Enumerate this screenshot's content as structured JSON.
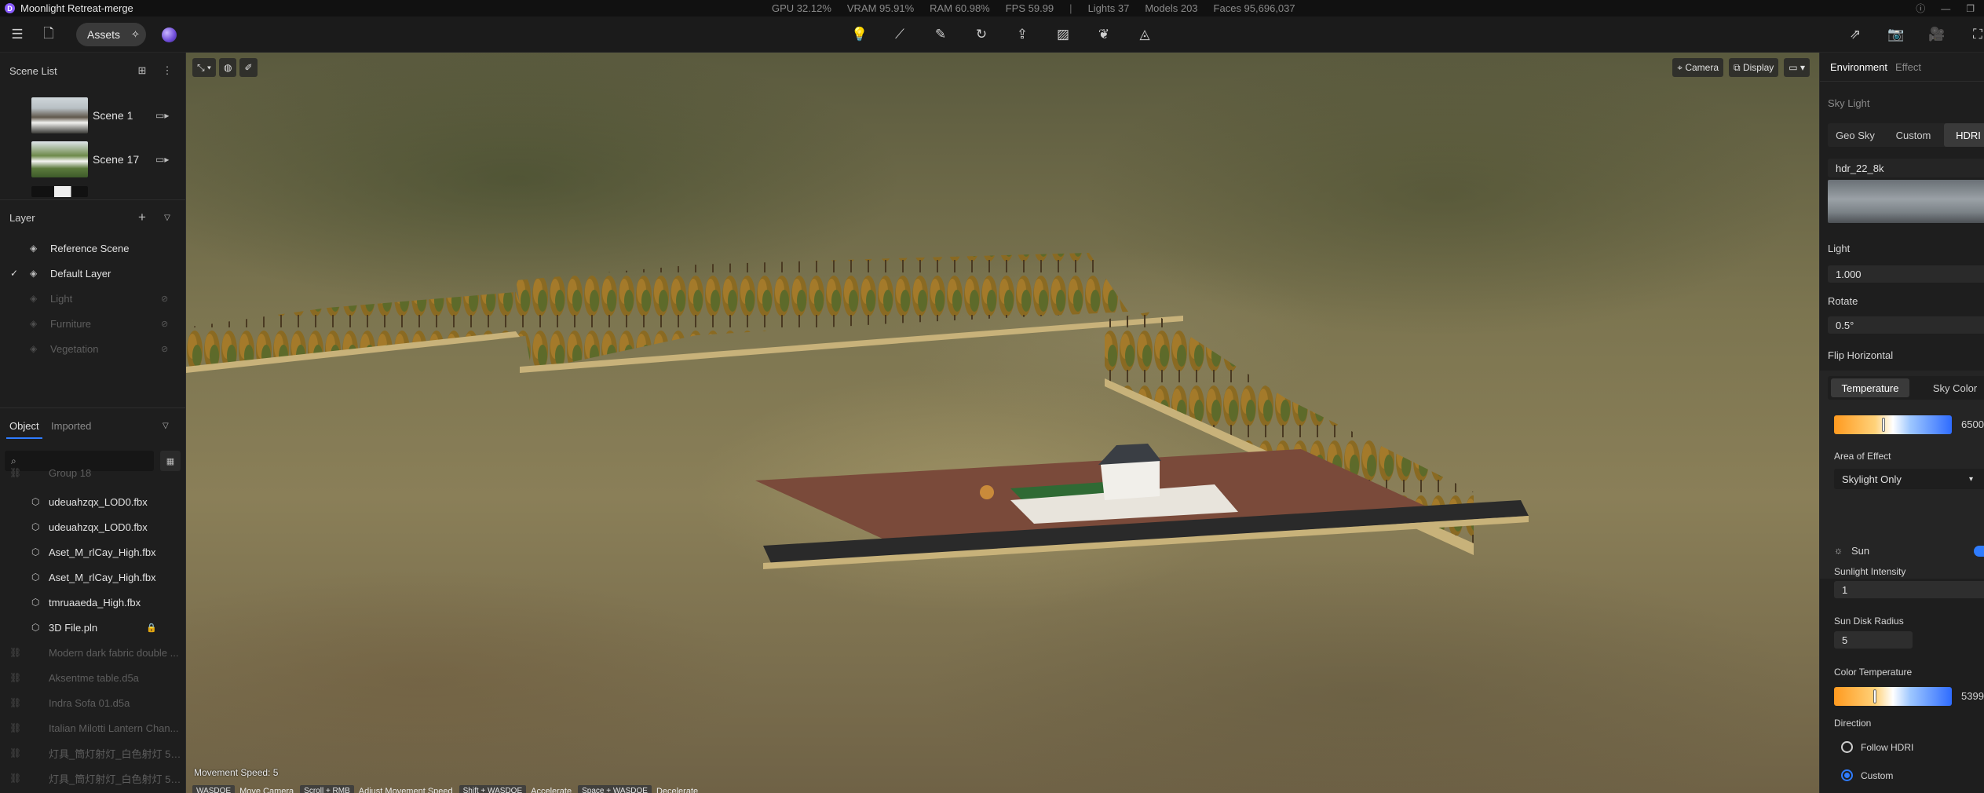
{
  "titlebar": {
    "app_icon": "D",
    "title": "Moonlight Retreat-merge",
    "stats": [
      "GPU 32.12%",
      "VRAM 95.91%",
      "RAM 60.98%",
      "FPS 59.99",
      "|",
      "Lights 37",
      "Models 203",
      "Faces 95,696,037"
    ],
    "window_controls": [
      "help-icon",
      "minimize-icon",
      "maximize-icon"
    ]
  },
  "toolbar": {
    "assets_label": "Assets",
    "center_tools": [
      "light-icon",
      "path-icon",
      "feather-icon",
      "rotate-icon",
      "import-icon",
      "material-icon",
      "plant-icon",
      "terrain-icon"
    ],
    "right_tools": [
      "export-icon",
      "camera-icon",
      "video-icon",
      "render-icon"
    ]
  },
  "scene_list": {
    "title": "Scene List",
    "scenes": [
      {
        "label": "Scene 1"
      },
      {
        "label": "Scene 17"
      }
    ]
  },
  "layers": {
    "title": "Layer",
    "items": [
      {
        "label": "Reference Scene",
        "checked": false,
        "visible": true
      },
      {
        "label": "Default Layer",
        "checked": true,
        "visible": true
      },
      {
        "label": "Light",
        "checked": false,
        "visible": false
      },
      {
        "label": "Furniture",
        "checked": false,
        "visible": false
      },
      {
        "label": "Vegetation",
        "checked": false,
        "visible": false
      }
    ]
  },
  "objects": {
    "tabs": [
      "Object",
      "Imported"
    ],
    "active_tab": "Object",
    "search_placeholder": "",
    "partial_top": "Group 18",
    "items": [
      {
        "label": "udeuahzqx_LOD0.fbx",
        "dim": false,
        "locked": false
      },
      {
        "label": "udeuahzqx_LOD0.fbx",
        "dim": false,
        "locked": false
      },
      {
        "label": "Aset_M_rlCay_High.fbx",
        "dim": false,
        "locked": false
      },
      {
        "label": "Aset_M_rlCay_High.fbx",
        "dim": false,
        "locked": false
      },
      {
        "label": "tmruaaeda_High.fbx",
        "dim": false,
        "locked": false
      },
      {
        "label": "3D File.pln",
        "dim": false,
        "locked": true
      },
      {
        "label": "Modern dark fabric double ...",
        "dim": true,
        "locked": false
      },
      {
        "label": "Aksentme table.d5a",
        "dim": true,
        "locked": false
      },
      {
        "label": "Indra Sofa 01.d5a",
        "dim": true,
        "locked": false
      },
      {
        "label": "Italian Milotti Lantern Chan...",
        "dim": true,
        "locked": false
      },
      {
        "label": "灯具_筒灯射灯_白色射灯 52...",
        "dim": true,
        "locked": false
      },
      {
        "label": "灯具_筒灯射灯_白色射灯 52...",
        "dim": true,
        "locked": false
      }
    ]
  },
  "viewport": {
    "camera_label": "Camera",
    "display_label": "Display",
    "movement_speed": "Movement Speed: 5",
    "hints": [
      {
        "key": "WASDQE",
        "action": "Move Camera"
      },
      {
        "key": "Scroll + RMB",
        "action": "Adjust Movement Speed"
      },
      {
        "key": "Shift + WASDQE",
        "action": "Accelerate"
      },
      {
        "key": "Space + WASDQE",
        "action": "Decelerate"
      }
    ]
  },
  "right_panel": {
    "tabs": [
      "Environment",
      "Effect"
    ],
    "active_tab": "Environment",
    "sky_light_title": "Sky Light",
    "sky_modes": [
      "Geo Sky",
      "Custom",
      "HDRI"
    ],
    "active_sky_mode": "HDRI",
    "hdri_name": "hdr_22_8k",
    "light_label": "Light",
    "light_value": "1.000",
    "rotate_label": "Rotate",
    "rotate_value": "0.5°",
    "flip_label": "Flip Horizontal",
    "color_tabs": [
      "Temperature",
      "Sky Color"
    ],
    "active_color_tab": "Temperature",
    "temperature_value": "6500",
    "temperature_level": 0.42,
    "area_label": "Area of Effect",
    "area_value": "Skylight Only",
    "sun_label": "Sun",
    "sun_enabled": true,
    "sun_intensity_label": "Sunlight Intensity",
    "sun_intensity_value": "1",
    "sun_disk_label": "Sun Disk Radius",
    "sun_disk_value": "5",
    "color_temp_label": "Color Temperature",
    "color_temp_value": "5399",
    "color_temp_level": 0.34,
    "direction_label": "Direction",
    "direction_options": [
      "Follow HDRI",
      "Custom"
    ],
    "direction_selected": "Custom"
  },
  "colors": {
    "accent": "#2f7cff",
    "logo": "#8a5cff",
    "panel_bg": "#1e1e1e",
    "toolbar_bg": "#1b1b1b"
  }
}
